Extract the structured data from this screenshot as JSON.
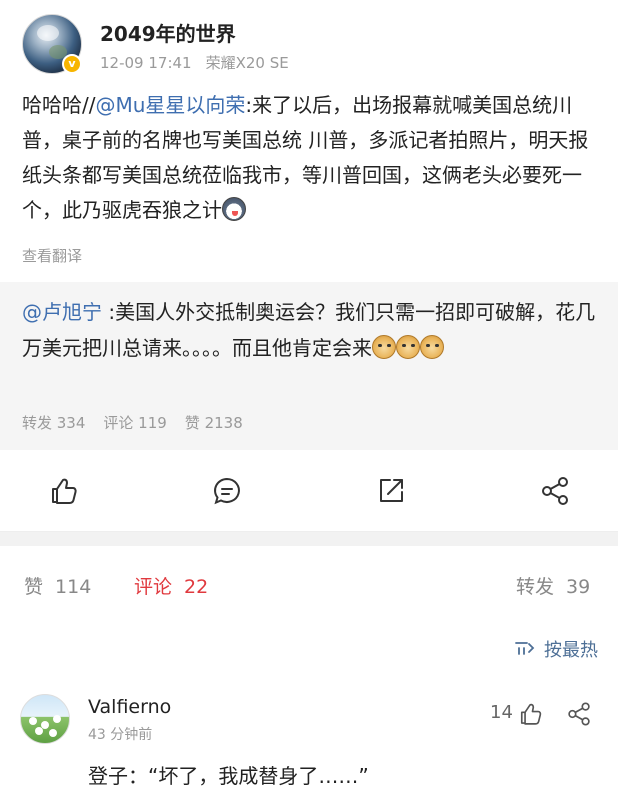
{
  "post": {
    "username": "2049年的世界",
    "date": "12-09 17:41",
    "device": "荣耀X20 SE",
    "text_prefix": "哈哈哈//",
    "mention": "@Mu星星以向荣",
    "text_body": ":来了以后，出场报幕就喊美国总统川普，桌子前的名牌也写美国总统 川普，多派记者拍照片，明天报纸头条都写美国总统莅临我市，等川普回国，这俩老头必要死一个，此乃驱虎吞狼之计",
    "emoji_end": "husky-emoji",
    "translate_label": "查看翻译"
  },
  "repost": {
    "mention": "@卢旭宁",
    "text": " :美国人外交抵制奥运会？我们只需一招即可破解，花几万美元把川总请来。。。。而且他肯定会来",
    "emojis": [
      "doge-emoji",
      "doge-emoji",
      "doge-emoji"
    ],
    "stats": {
      "forward": "转发 334",
      "comment": "评论 119",
      "like": "赞 2138"
    }
  },
  "actions": {
    "icons": [
      "thumbs-up-icon",
      "comment-icon",
      "forward-icon",
      "share-icon"
    ]
  },
  "tabs": {
    "like_label": "赞",
    "like_count": "114",
    "comment_label": "评论",
    "comment_count": "22",
    "forward_label": "转发",
    "forward_count": "39"
  },
  "sort": {
    "icon": "sort-icon",
    "label": "按最热"
  },
  "comment": {
    "name": "Valfierno",
    "time": "43 分钟前",
    "likes": "14",
    "text": "登子：“坏了，我成替身了……”"
  },
  "colors": {
    "accent_red": "#e0393e",
    "link_blue": "#3e6eb0",
    "sort_blue": "#4d6f96",
    "muted": "#9a9a9a"
  }
}
